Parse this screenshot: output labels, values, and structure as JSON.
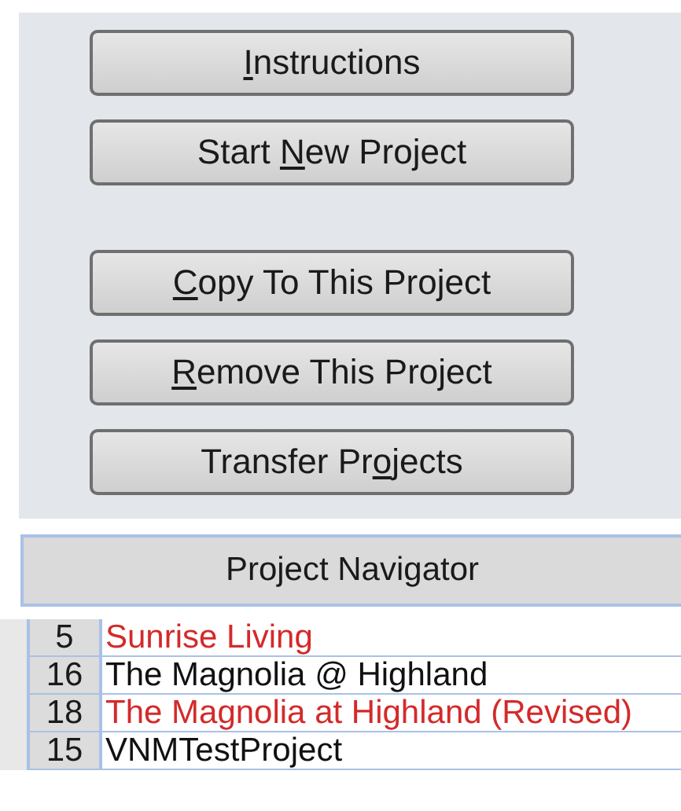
{
  "button_groups": [
    [
      {
        "key": "I",
        "after": "nstructions"
      },
      {
        "before": "Start ",
        "key": "N",
        "after": "ew Project"
      }
    ],
    [
      {
        "key": "C",
        "after": "opy To This Project"
      },
      {
        "key": "R",
        "after": "emove This Project"
      },
      {
        "before": "Transfer Pr",
        "key": "o",
        "after": "jects"
      }
    ]
  ],
  "navigator": {
    "title": "Project Navigator",
    "rows": [
      {
        "id": "5",
        "name": "Sunrise Living",
        "color": "#d42a2a"
      },
      {
        "id": "16",
        "name": "The Magnolia @ Highland",
        "color": "#111111"
      },
      {
        "id": "18",
        "name": "The Magnolia at Highland (Revised)",
        "color": "#d42a2a"
      },
      {
        "id": "15",
        "name": "VNMTestProject",
        "color": "#111111"
      }
    ]
  }
}
